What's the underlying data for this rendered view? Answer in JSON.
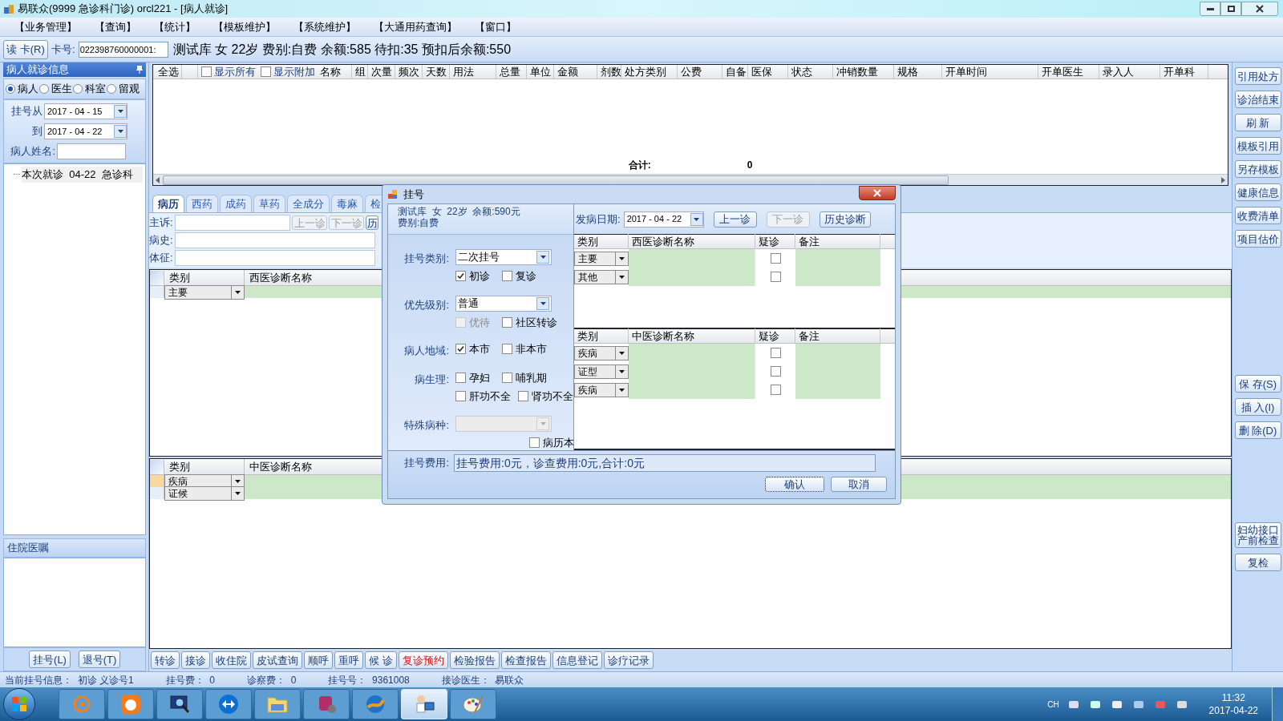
{
  "window": {
    "title": "易联众(9999 急诊科门诊) orcl221 - [病人就诊]"
  },
  "menu": [
    "【业务管理】",
    "【查询】",
    "【统计】",
    "【模板维护】",
    "【系统维护】",
    "【大通用药查询】",
    "【窗口】"
  ],
  "card_bar": {
    "read_button": "读 卡(R)",
    "card_label": "卡号:",
    "card_number": "022398760000001:",
    "patient_info": "测试库 女 22岁 费别:自费 余额:585 待扣:35 预扣后余额:550"
  },
  "left_panel": {
    "title": "病人就诊信息",
    "modes": [
      {
        "label": "病人",
        "selected": true
      },
      {
        "label": "医生",
        "selected": false
      },
      {
        "label": "科室",
        "selected": false
      },
      {
        "label": "留观",
        "selected": false
      }
    ],
    "date_from_label": "挂号从",
    "date_from": "2017 - 04 - 15",
    "date_to_label": "到",
    "date_to": "2017 - 04 - 22",
    "name_label": "病人姓名:",
    "tree": [
      {
        "label": "本次就诊  04-22  急诊科"
      }
    ],
    "orders_title": "住院医嘱",
    "buttons": [
      "挂号(L)",
      "退号(T)"
    ]
  },
  "rx_grid": {
    "select_all": "全选",
    "toggles": [
      {
        "label": "显示所有",
        "checked": false
      },
      {
        "label": "显示附加",
        "checked": false
      }
    ],
    "columns": [
      "名称",
      "组",
      "次量",
      "频次",
      "天数",
      "用法",
      "总量",
      "单位",
      "金额",
      "剂数",
      "处方类别",
      "公费",
      "自备",
      "医保",
      "状态",
      "冲销数量",
      "规格",
      "开单时间",
      "开单医生",
      "录入人",
      "开单科"
    ],
    "total_label": "合计:",
    "total": "0"
  },
  "tabs": [
    {
      "label": "病历",
      "selected": true
    },
    {
      "label": "西药",
      "selected": false
    },
    {
      "label": "成药",
      "selected": false
    },
    {
      "label": "草药",
      "selected": false
    },
    {
      "label": "全成分",
      "selected": false
    },
    {
      "label": "毒麻",
      "selected": false
    },
    {
      "label": "检",
      "selected": false
    }
  ],
  "record_fields": [
    {
      "label": "主诉:"
    },
    {
      "label": "病史:"
    },
    {
      "label": "体征:"
    }
  ],
  "record_nav": [
    "上一诊",
    "下一诊",
    "历"
  ],
  "western_grid": {
    "columns": [
      "类别",
      "西医诊断名称"
    ],
    "rows": [
      {
        "category": "主要",
        "selected": false
      }
    ]
  },
  "chinese_grid": {
    "columns": [
      "类别",
      "中医诊断名称"
    ],
    "rows": [
      {
        "category": "疾病",
        "selected": true
      },
      {
        "category": "证候",
        "selected": false
      }
    ]
  },
  "action_buttons": [
    {
      "label": "转诊",
      "kind": "normal"
    },
    {
      "label": "接诊",
      "kind": "normal"
    },
    {
      "label": "收住院",
      "kind": "normal"
    },
    {
      "label": "皮试查询",
      "kind": "normal"
    },
    {
      "label": "顺呼",
      "kind": "normal"
    },
    {
      "label": "重呼",
      "kind": "normal"
    },
    {
      "label": "候 诊",
      "kind": "normal"
    },
    {
      "label": "复诊预约",
      "kind": "alert"
    },
    {
      "label": "检验报告",
      "kind": "normal"
    },
    {
      "label": "检查报告",
      "kind": "normal"
    },
    {
      "label": "信息登记",
      "kind": "normal"
    },
    {
      "label": "诊疗记录",
      "kind": "normal"
    }
  ],
  "side_buttons": {
    "top": [
      "引用处方",
      "诊治结束",
      "刷 新",
      "模板引用",
      "另存模板",
      "健康信息",
      "收费清单",
      "项目估价"
    ],
    "middle": [
      "保 存(S)",
      "插 入(I)",
      "删 除(D)"
    ],
    "bottom": [
      {
        "lines": [
          "妇幼接口",
          "产前检查"
        ]
      },
      {
        "lines": [
          "复检"
        ]
      }
    ]
  },
  "status_bar": [
    {
      "label": "当前挂号信息：",
      "value": "初诊 义诊号1"
    },
    {
      "label": "挂号费：",
      "value": "0"
    },
    {
      "label": "诊察费：",
      "value": "0"
    },
    {
      "label": "挂号号：",
      "value": "9361008"
    },
    {
      "label": "接诊医生：",
      "value": "易联众"
    }
  ],
  "taskbar": {
    "apps": [
      {
        "kind": "target",
        "selected": false
      },
      {
        "kind": "browser",
        "selected": false
      },
      {
        "kind": "sql",
        "selected": false
      },
      {
        "kind": "remote",
        "selected": false
      },
      {
        "kind": "folder",
        "selected": false
      },
      {
        "kind": "database",
        "selected": false
      },
      {
        "kind": "sphere",
        "selected": false
      },
      {
        "kind": "doctor",
        "selected": true
      },
      {
        "kind": "paint",
        "selected": false
      }
    ],
    "language": "CH",
    "time": "11:32",
    "date": "2017-04-22"
  },
  "dialog": {
    "title": "挂号",
    "patient_line": "测试库  女  22岁  余额:590元",
    "fee_type": "费别:自费",
    "onset_label": "发病日期:",
    "onset_date": "2017 - 04 - 22",
    "nav_buttons": [
      {
        "label": "上一诊",
        "disabled": false
      },
      {
        "label": "下一诊",
        "disabled": true
      },
      {
        "label": "历史诊断",
        "disabled": false
      }
    ],
    "fields": [
      {
        "kind": "select",
        "label": "挂号类别:",
        "value": "二次挂号",
        "disabled": false,
        "options": [
          {
            "label": "初诊",
            "checked": true,
            "disabled": false
          },
          {
            "label": "复诊",
            "checked": false,
            "disabled": false
          }
        ]
      },
      {
        "kind": "select",
        "label": "优先级别:",
        "value": "普通",
        "disabled": false,
        "options": [
          {
            "label": "优待",
            "checked": false,
            "disabled": true
          },
          {
            "label": "社区转诊",
            "checked": false,
            "disabled": false
          }
        ]
      },
      {
        "kind": "checks",
        "label": "病人地域:",
        "options": [
          {
            "label": "本市",
            "checked": true,
            "disabled": false
          },
          {
            "label": "非本市",
            "checked": false,
            "disabled": false
          }
        ]
      },
      {
        "kind": "checks",
        "label": "病生理:",
        "options": [
          {
            "label": "孕妇",
            "checked": false,
            "disabled": false
          },
          {
            "label": "哺乳期",
            "checked": false,
            "disabled": false
          },
          {
            "label": "肝功不全",
            "checked": false,
            "disabled": false
          },
          {
            "label": "肾功不全",
            "checked": false,
            "disabled": false
          }
        ]
      },
      {
        "kind": "select",
        "label": "特殊病种:",
        "disabled": true,
        "options": [
          {
            "label": "病历本",
            "checked": false,
            "disabled": false
          }
        ]
      }
    ],
    "western_grid": {
      "columns": [
        "类别",
        "西医诊断名称",
        "疑诊",
        "备注"
      ],
      "rows": [
        {
          "category": "主要",
          "suspected": false
        },
        {
          "category": "其他",
          "suspected": false
        }
      ]
    },
    "chinese_grid": {
      "columns": [
        "类别",
        "中医诊断名称",
        "疑诊",
        "备注"
      ],
      "rows": [
        {
          "category": "疾病",
          "suspected": false
        },
        {
          "category": "证型",
          "suspected": false
        },
        {
          "category": "疾病",
          "suspected": false
        }
      ]
    },
    "fee_label": "挂号费用:",
    "fee_text": "挂号费用:0元，诊查费用:0元,合计:0元",
    "ok": "确认",
    "cancel": "取消"
  }
}
